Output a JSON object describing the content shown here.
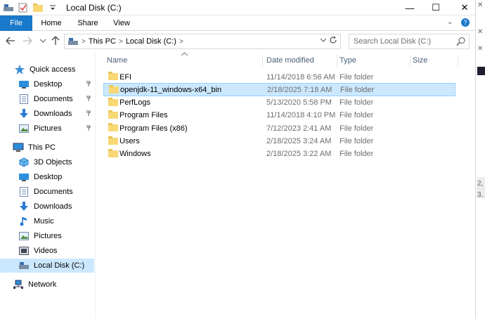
{
  "window": {
    "title": "Local Disk (C:)",
    "controls": {
      "minimize": "—",
      "maximize": "☐",
      "close": "✕"
    }
  },
  "ribbon": {
    "tabs": [
      "File",
      "Home",
      "Share",
      "View"
    ],
    "expand_glyph": "⌄",
    "help_glyph": "?"
  },
  "address": {
    "crumbs": [
      "This PC",
      "Local Disk (C:)"
    ],
    "separator": ">"
  },
  "search": {
    "placeholder": "Search Local Disk (C:)"
  },
  "columns": {
    "name": "Name",
    "date": "Date modified",
    "type": "Type",
    "size": "Size"
  },
  "files": [
    {
      "name": "EFI",
      "date": "11/14/2018 6:56 AM",
      "type": "File folder",
      "selected": false
    },
    {
      "name": "openjdk-11_windows-x64_bin",
      "date": "2/18/2025 7:18 AM",
      "type": "File folder",
      "selected": true
    },
    {
      "name": "PerfLogs",
      "date": "5/13/2020 5:58 PM",
      "type": "File folder",
      "selected": false
    },
    {
      "name": "Program Files",
      "date": "11/14/2018 4:10 PM",
      "type": "File folder",
      "selected": false
    },
    {
      "name": "Program Files (x86)",
      "date": "7/12/2023 2:41 AM",
      "type": "File folder",
      "selected": false
    },
    {
      "name": "Users",
      "date": "2/18/2025 3:24 AM",
      "type": "File folder",
      "selected": false
    },
    {
      "name": "Windows",
      "date": "2/18/2025 3:22 AM",
      "type": "File folder",
      "selected": false
    }
  ],
  "nav": {
    "quick_access": "Quick access",
    "qa_desktop": "Desktop",
    "qa_documents": "Documents",
    "qa_downloads": "Downloads",
    "qa_pictures": "Pictures",
    "this_pc": "This PC",
    "objects3d": "3D Objects",
    "desktop": "Desktop",
    "documents": "Documents",
    "downloads": "Downloads",
    "music": "Music",
    "pictures": "Pictures",
    "videos": "Videos",
    "local_disk": "Local Disk (C:)",
    "network": "Network"
  },
  "right_edge": {
    "text1": "2,",
    "text2": "3,"
  },
  "colors": {
    "accent": "#1979ca",
    "selection": "#cce8ff",
    "folder": "#f8d775"
  }
}
